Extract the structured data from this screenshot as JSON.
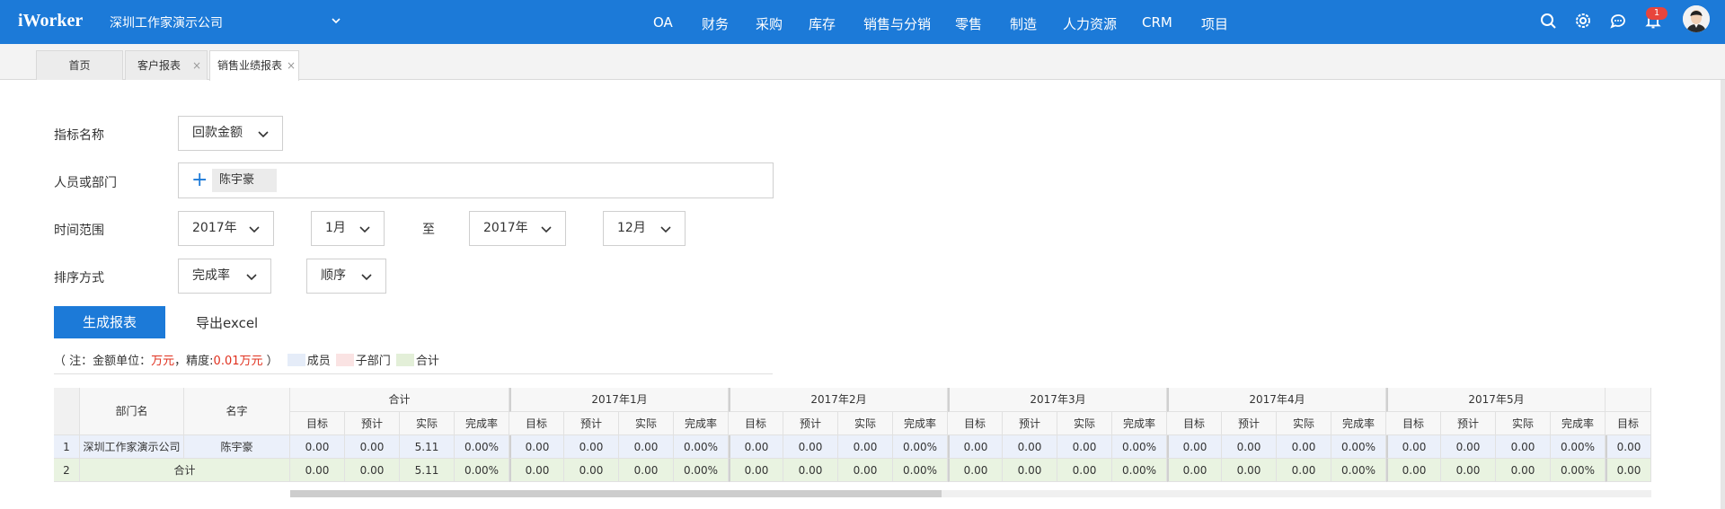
{
  "app": {
    "logo": "iWorker",
    "company": "深圳工作家演示公司"
  },
  "nav": [
    "OA",
    "财务",
    "采购",
    "库存",
    "销售与分销",
    "零售",
    "制造",
    "人力资源",
    "CRM",
    "项目"
  ],
  "notifications": {
    "count": "1"
  },
  "tabs": [
    {
      "label": "首页",
      "closable": false
    },
    {
      "label": "客户报表",
      "closable": true
    },
    {
      "label": "销售业绩报表",
      "closable": true,
      "active": true
    }
  ],
  "form": {
    "indicator": {
      "label": "指标名称",
      "value": "回款金额"
    },
    "person": {
      "label": "人员或部门",
      "tag": "陈宇豪"
    },
    "time": {
      "label": "时间范围",
      "start_year": "2017年",
      "start_month": "1月",
      "to": "至",
      "end_year": "2017年",
      "end_month": "12月"
    },
    "sort": {
      "label": "排序方式",
      "field": "完成率",
      "order": "顺序"
    },
    "generate_button": "生成报表",
    "export_button": "导出excel"
  },
  "note": {
    "prefix": "（ 注：金额单位：",
    "unit": "万元",
    "mid": "，精度:",
    "precision": "0.01万元",
    "suffix": " ）",
    "legend": [
      {
        "label": "成员",
        "color": "#e5ecf8"
      },
      {
        "label": "子部门",
        "color": "#fae3e3"
      },
      {
        "label": "合计",
        "color": "#e3efd8"
      }
    ]
  },
  "table": {
    "col_dept": "部门名",
    "col_name": "名字",
    "groups": [
      "合计",
      "2017年1月",
      "2017年2月",
      "2017年3月",
      "2017年4月",
      "2017年5月"
    ],
    "sub_headers": [
      "目标",
      "预计",
      "实际",
      "完成率"
    ],
    "rows": [
      {
        "num": "1",
        "dept": "深圳工作家演示公司",
        "name": "陈宇豪",
        "type": "member",
        "values": [
          "0.00",
          "0.00",
          "5.11",
          "0.00%",
          "0.00",
          "0.00",
          "0.00",
          "0.00%",
          "0.00",
          "0.00",
          "0.00",
          "0.00%",
          "0.00",
          "0.00",
          "0.00",
          "0.00%",
          "0.00",
          "0.00",
          "0.00",
          "0.00%",
          "0.00",
          "0.00",
          "0.00",
          "0.00%",
          "0.00"
        ]
      },
      {
        "num": "2",
        "dept": "合计",
        "name": "",
        "type": "total",
        "values": [
          "0.00",
          "0.00",
          "5.11",
          "0.00%",
          "0.00",
          "0.00",
          "0.00",
          "0.00%",
          "0.00",
          "0.00",
          "0.00",
          "0.00%",
          "0.00",
          "0.00",
          "0.00",
          "0.00%",
          "0.00",
          "0.00",
          "0.00",
          "0.00%",
          "0.00",
          "0.00",
          "0.00",
          "0.00%",
          "0.00"
        ]
      }
    ]
  }
}
